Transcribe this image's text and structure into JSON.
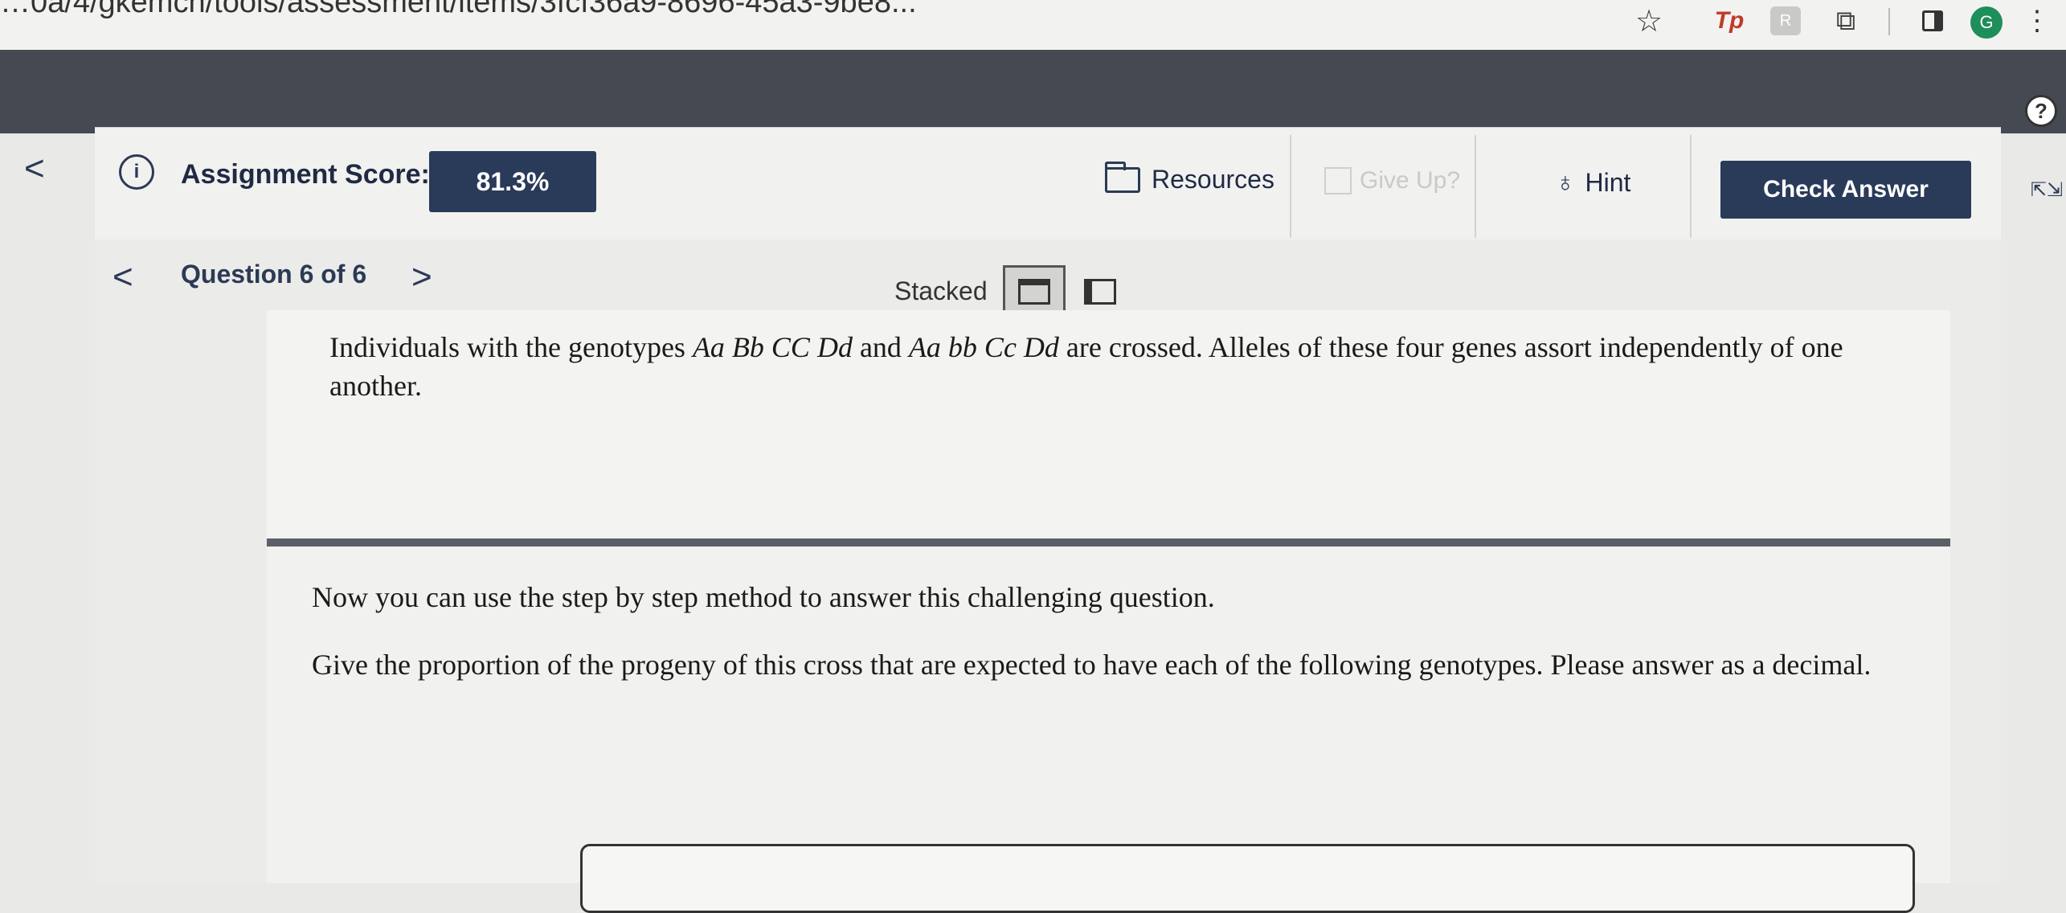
{
  "browser": {
    "url": "…0a/4/gkemch/tools/assessment/items/3fcf36a9-8696-45a3-9be8...",
    "ext_tp": "Tp",
    "ext_r": "R",
    "avatar_letter": "G"
  },
  "toolbar": {
    "score_label": "Assignment Score:",
    "score_value": "81.3%",
    "resources_label": "Resources",
    "give_up_label": "Give Up?",
    "hint_label": "Hint",
    "check_label": "Check Answer"
  },
  "nav": {
    "question_label": "Question 6 of 6",
    "stacked_label": "Stacked"
  },
  "question": {
    "intro_a": "Individuals with the genotypes ",
    "genotype1": "Aa Bb CC Dd",
    "intro_b": " and ",
    "genotype2": "Aa bb Cc Dd",
    "intro_c": " are crossed. Alleles of these four genes assort independently of one another.",
    "step_text": "Now you can use the step by step method to answer this challenging question.",
    "instruction": "Give the proportion of the progeny of this cross that are expected to have each of the following genotypes. Please answer as a decimal."
  },
  "colors": {
    "navy": "#2a3a59",
    "header": "#454a52"
  }
}
